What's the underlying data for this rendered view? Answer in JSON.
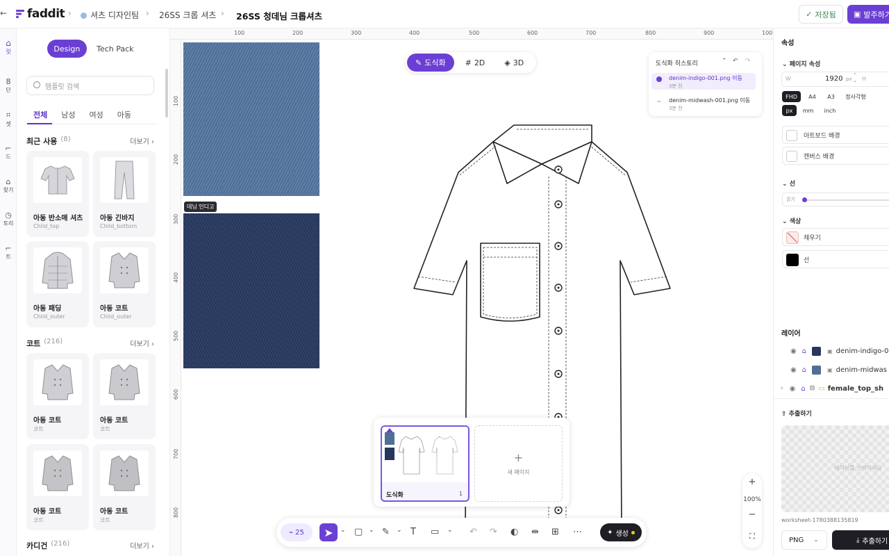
{
  "header": {
    "brand": "faddit",
    "crumbs": [
      "셔츠 디자인팀",
      "26SS 크롭 셔츠",
      "26SS 청데님 크롭셔츠"
    ],
    "saved_label": "저장됨",
    "order_label": "발주하기"
  },
  "rail": {
    "items": [
      "릿",
      "단",
      "셋",
      "드",
      "찾기",
      "토리",
      "트"
    ]
  },
  "left": {
    "tabs": [
      "Design",
      "Tech Pack"
    ],
    "search_placeholder": "템플릿 검색",
    "filters": [
      "전체",
      "남성",
      "여성",
      "아동"
    ],
    "sections": [
      {
        "title": "최근 사용",
        "count": "(8)",
        "more": "더보기 ›",
        "items": [
          {
            "name": "아동 반소매 셔츠",
            "sub": "Child_top"
          },
          {
            "name": "아동 긴바지",
            "sub": "Child_bottom"
          },
          {
            "name": "아동 패딩",
            "sub": "Child_outer"
          },
          {
            "name": "아동 코트",
            "sub": "Child_outer"
          }
        ]
      },
      {
        "title": "코트",
        "count": "(216)",
        "more": "더보기 ›",
        "items": [
          {
            "name": "아동 코트",
            "sub": "코트"
          },
          {
            "name": "아동 코트",
            "sub": "코트"
          },
          {
            "name": "아동 코트",
            "sub": "코트"
          },
          {
            "name": "아동 코트",
            "sub": "코트"
          }
        ]
      },
      {
        "title": "카디건",
        "count": "(216)",
        "more": "더보기 ›",
        "items": []
      }
    ]
  },
  "canvas": {
    "ruler_top": [
      "100",
      "200",
      "300",
      "400",
      "500",
      "600",
      "700",
      "800",
      "900",
      "100"
    ],
    "ruler_left": [
      "100",
      "200",
      "300",
      "400",
      "500",
      "600",
      "700",
      "800"
    ],
    "swatch_label": "데님 인디고",
    "modes": [
      "도식화",
      "2D",
      "3D"
    ],
    "history": {
      "title": "도식화 히스토리",
      "rows": [
        {
          "text": "denim-indigo-001.png 이동",
          "time": "3분 전"
        },
        {
          "text": "denim-midwash-001.png 이동",
          "time": "3분 전"
        }
      ]
    },
    "page": {
      "label": "도식화",
      "number": "1"
    },
    "new_page": "새 페이지",
    "toolbar": {
      "count": "25",
      "generate": "생성"
    },
    "zoom": "100%",
    "colors": {
      "accent": "#6b3fd4",
      "indigo": "#27365a",
      "midwash": "#4f6f98"
    }
  },
  "right": {
    "title": "속성",
    "page_props": "페이지 속성",
    "w_label": "W",
    "w_value": "1920",
    "w_unit": "px",
    "h_label": "H",
    "sizes": [
      "FHD",
      "A4",
      "A3",
      "정사각형"
    ],
    "units": [
      "px",
      "mm",
      "inch"
    ],
    "artboard_bg": "아트보드 배경",
    "canvas_bg": "캔버스 배경",
    "line_section": "선",
    "line_label": "굵기",
    "color_section": "색상",
    "fill_label": "채우기",
    "stroke_label": "선",
    "layers_title": "레이어",
    "layers": [
      "denim-indigo-0",
      "denim-midwas",
      "female_top_sh"
    ],
    "export_title": "추출하기",
    "export_hint": "레이어를 선택하세요",
    "worksheet": "worksheet-1780388135819",
    "format": "PNG",
    "export_button": "추출하기"
  }
}
